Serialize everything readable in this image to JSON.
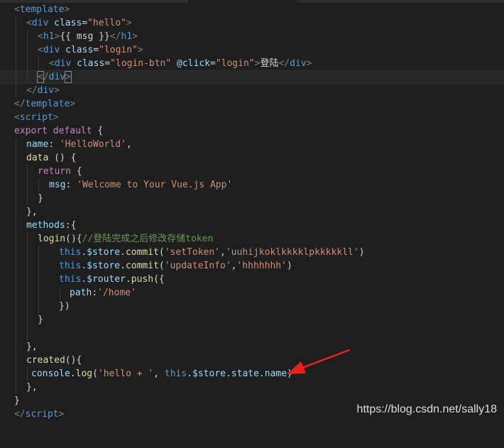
{
  "code": {
    "l1_tag": "template",
    "l2_tag": "div",
    "l2_attr": "class",
    "l2_val": "\"hello\"",
    "l3_tag": "h1",
    "l3_text": "{{ msg }}",
    "l3_close": "h1",
    "l4_tag": "div",
    "l4_attr": "class",
    "l4_val": "\"login\"",
    "l5_tag": "div",
    "l5_attr": "class",
    "l5_val": "\"login-btn\"",
    "l5_event": "@click",
    "l5_handler": "\"login\"",
    "l5_text": "登陆",
    "l5_close": "div",
    "l6_close": "div",
    "l7_close": "div",
    "l8_close": "template",
    "l9_tag": "script",
    "l10_kw1": "export",
    "l10_kw2": "default",
    "l10_rest": " {",
    "l11_key": "name",
    "l11_val": "'HelloWorld'",
    "l12_fn": "data",
    "l12_rest": " () {",
    "l13_kw": "return",
    "l13_rest": " {",
    "l14_key": "msg",
    "l14_val": "'Welcome to Your Vue.js App'",
    "l15": "}",
    "l16": "},",
    "l17_key": "methods",
    "l17_rest": ":{",
    "l18_fn": "login",
    "l18_rest": "(){",
    "l18_comment": "//登陆完成之后修改存储token",
    "l19_this": "this",
    "l19_mid": ".$store.",
    "l19_fn": "commit",
    "l19_p1": "(",
    "l19_s1": "'setToken'",
    "l19_comma": ",",
    "l19_s2": "'uuhijkoklkkkklpkkkkkll'",
    "l19_p2": ")",
    "l20_this": "this",
    "l20_mid": ".$store.",
    "l20_fn": "commit",
    "l20_p1": "(",
    "l20_s1": "'updateInfo'",
    "l20_comma": ",",
    "l20_s2": "'hhhhhhh'",
    "l20_p2": ")",
    "l21_this": "this",
    "l21_mid": ".$router.",
    "l21_fn": "push",
    "l21_rest": "({",
    "l22_key": "path",
    "l22_val": "'/home'",
    "l23": "})",
    "l24": "}",
    "l26": "},",
    "l27_fn": "created",
    "l27_rest": "(){",
    "l28_obj": "console",
    "l28_dot": ".",
    "l28_fn": "log",
    "l28_p1": "(",
    "l28_s1": "'hello + '",
    "l28_comma": ", ",
    "l28_this": "this",
    "l28_rest": ".$store.state.name",
    "l28_p2": ")",
    "l29": "},",
    "l30": "}",
    "l31_close": "script"
  },
  "watermark": "https://blog.csdn.net/sally18",
  "colors": {
    "background": "#1e1e1e",
    "tag": "#569cd6",
    "attribute": "#9cdcfe",
    "string": "#ce9178",
    "keyword": "#c586c0",
    "function": "#dcdcaa",
    "comment": "#6a9955",
    "annotation_arrow": "#e8231c"
  }
}
